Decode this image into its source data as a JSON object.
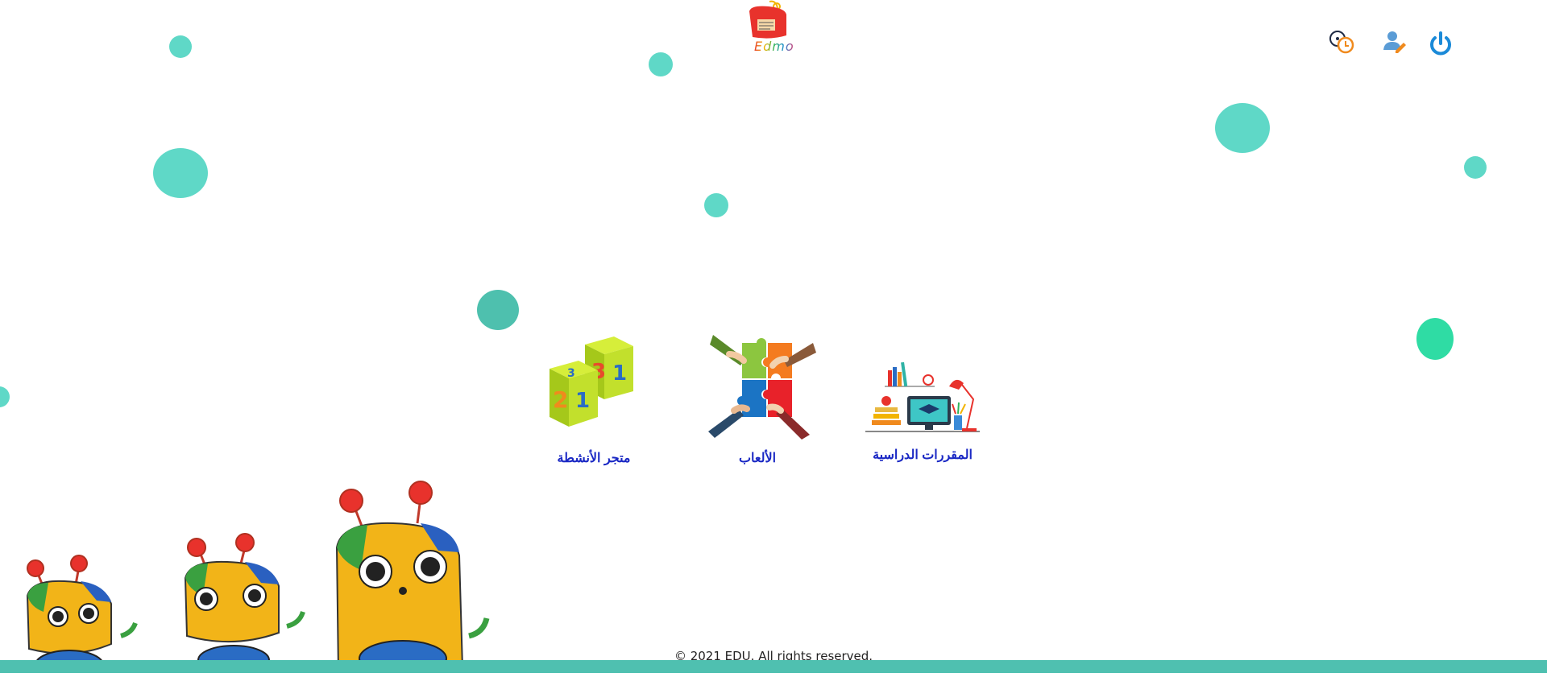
{
  "app": {
    "logo_text": "Edmo"
  },
  "header": {
    "icons": [
      {
        "name": "history-clock-icon"
      },
      {
        "name": "user-edit-icon"
      },
      {
        "name": "power-icon"
      }
    ]
  },
  "menu": {
    "items": [
      {
        "label": "متجر الأنشطة",
        "icon": "number-cubes-icon"
      },
      {
        "label": "الألعاب",
        "icon": "puzzle-hands-icon"
      },
      {
        "label": "المقررات الدراسية",
        "icon": "study-desk-icon"
      }
    ]
  },
  "footer": {
    "copyright": "© 2021 EDU. All rights reserved."
  },
  "colors": {
    "accent_teal": "#5fd8c7",
    "link_blue": "#1a28c4",
    "footer_bar": "#4fc0b0",
    "power_blue": "#1b8ad8"
  }
}
